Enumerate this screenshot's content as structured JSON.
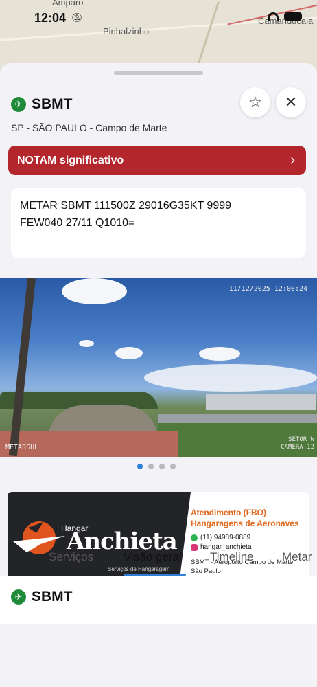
{
  "status_bar": {
    "time": "12:04"
  },
  "map": {
    "labels": [
      "Amparo",
      "Pinhalzinho",
      "Camanducaia"
    ]
  },
  "station": {
    "code": "SBMT",
    "subtitle": "SP - SÃO PAULO - Campo de Marte",
    "favorite_icon": "star-outline-icon",
    "close_icon": "close-icon"
  },
  "notam": {
    "label": "NOTAM significativo",
    "chevron": "›",
    "color": "#b3262b"
  },
  "metar": {
    "text_line1": "METAR SBMT 111500Z 29016G35KT 9999",
    "text_line2": "FEW040 27/11 Q1010="
  },
  "webcam": {
    "timestamp": "11/12/2025 12:00:24",
    "caption_left": "METARSUL",
    "caption_right_line1": "SETOR W",
    "caption_right_line2": "CAMERA 12"
  },
  "carousel": {
    "count": 4,
    "active": 0
  },
  "banner": {
    "hangar_word": "Hangar",
    "brand": "Anchieta",
    "tagline": "Serviços de Hangaragem",
    "line1": "Atendimento (FBO)",
    "line2": "Hangaragens de Aeronaves",
    "phone": "(11) 94989-0889",
    "instagram": "hangar_anchieta",
    "address_line1": "SBMT - Aeroporto Campo de Marte",
    "address_line2": "São Paulo"
  },
  "tabs": {
    "items": [
      "Serviços",
      "Visão geral",
      "Timeline",
      "Metar"
    ],
    "active": 1
  },
  "lower": {
    "code": "SBMT"
  },
  "colors": {
    "accent": "#2f7fd8",
    "station_badge": "#1f8a3a",
    "brand_orange": "#e06a1e"
  }
}
